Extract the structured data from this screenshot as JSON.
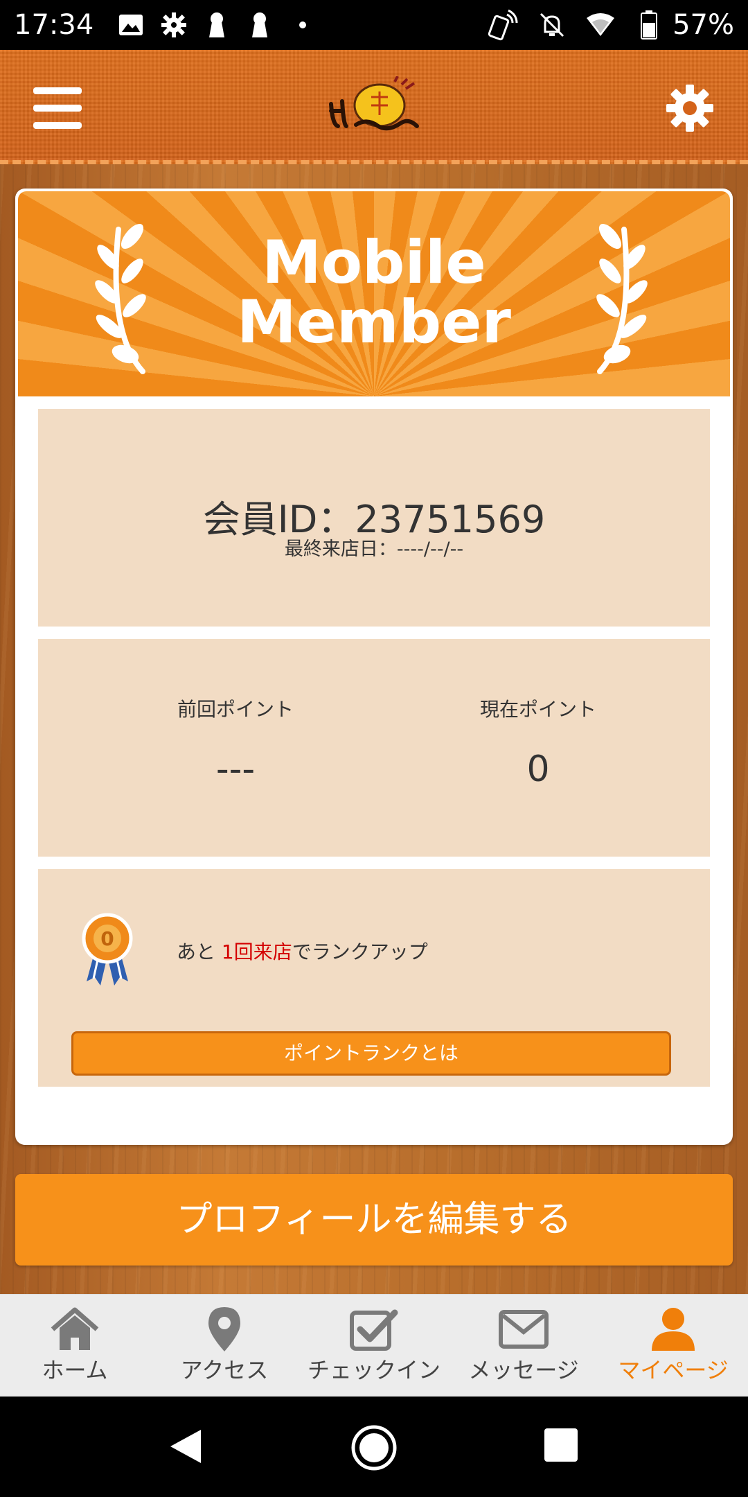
{
  "status_bar": {
    "time": "17:34",
    "battery_percent": "57%"
  },
  "header": {
    "logo_text": "ほまっちゃん",
    "menu_icon": "hamburger-menu-icon",
    "settings_icon": "gear-icon"
  },
  "banner": {
    "line1": "Mobile",
    "line2": "Member"
  },
  "member": {
    "id_text": "会員ID：23751569",
    "last_visit_text": "最終来店日：----/--/--"
  },
  "points": {
    "previous_label": "前回ポイント",
    "previous_value": "---",
    "current_label": "現在ポイント",
    "current_value": "0"
  },
  "rank": {
    "text_before": "あと ",
    "text_highlight": "1回来店",
    "text_after": "でランクアップ",
    "button_label": "ポイントランクとは",
    "medal_number": "0"
  },
  "edit_profile_button": "プロフィールを編集する",
  "bottom_nav": {
    "items": [
      {
        "label": "ホーム",
        "icon": "home-icon"
      },
      {
        "label": "アクセス",
        "icon": "map-pin-icon"
      },
      {
        "label": "チェックイン",
        "icon": "checkbox-icon"
      },
      {
        "label": "メッセージ",
        "icon": "envelope-icon"
      },
      {
        "label": "マイページ",
        "icon": "person-icon"
      }
    ],
    "active_index": 4,
    "active_color": "#f07f0a"
  },
  "colors": {
    "header_orange": "#d4631a",
    "accent_orange": "#f7911a",
    "panel_beige": "#f2dcc4",
    "highlight_red": "#d40000"
  }
}
